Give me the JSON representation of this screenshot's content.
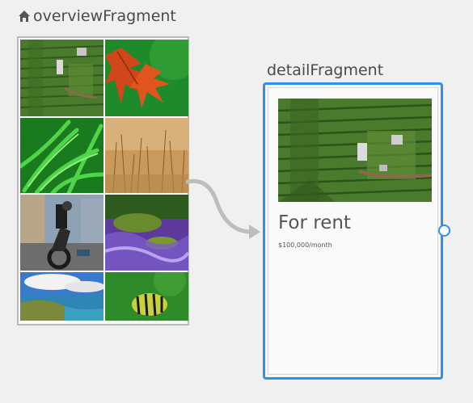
{
  "overview": {
    "title": "overviewFragment",
    "icon": "home-icon"
  },
  "detail": {
    "title": "detailFragment",
    "heading": "For rent",
    "price": "$100,000/month"
  },
  "colors": {
    "selection_blue": "#2f8ff0",
    "frame_gray": "#b9b9b9",
    "arrow_gray": "#bdbdbd"
  }
}
